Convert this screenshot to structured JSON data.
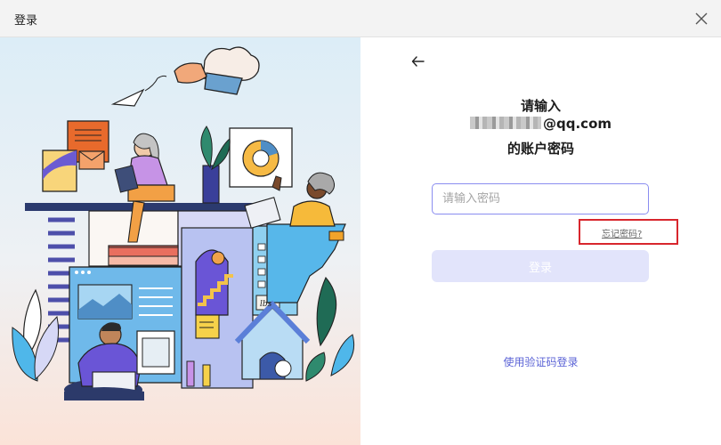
{
  "window": {
    "title": "登录"
  },
  "panel": {
    "heading_line1": "请输入",
    "heading_email_suffix": "@qq.com",
    "heading_line3": "的账户密码",
    "password_placeholder": "请输入密码",
    "forgot_label": "忘记密码?",
    "login_label": "登录",
    "code_login_label": "使用验证码登录"
  },
  "illustration": {
    "sign_text": "lbs"
  },
  "colors": {
    "accent": "#5b63d6",
    "input_border": "#8a8df0",
    "login_disabled_bg": "#e2e4fb",
    "highlight_box": "#d8262d"
  }
}
